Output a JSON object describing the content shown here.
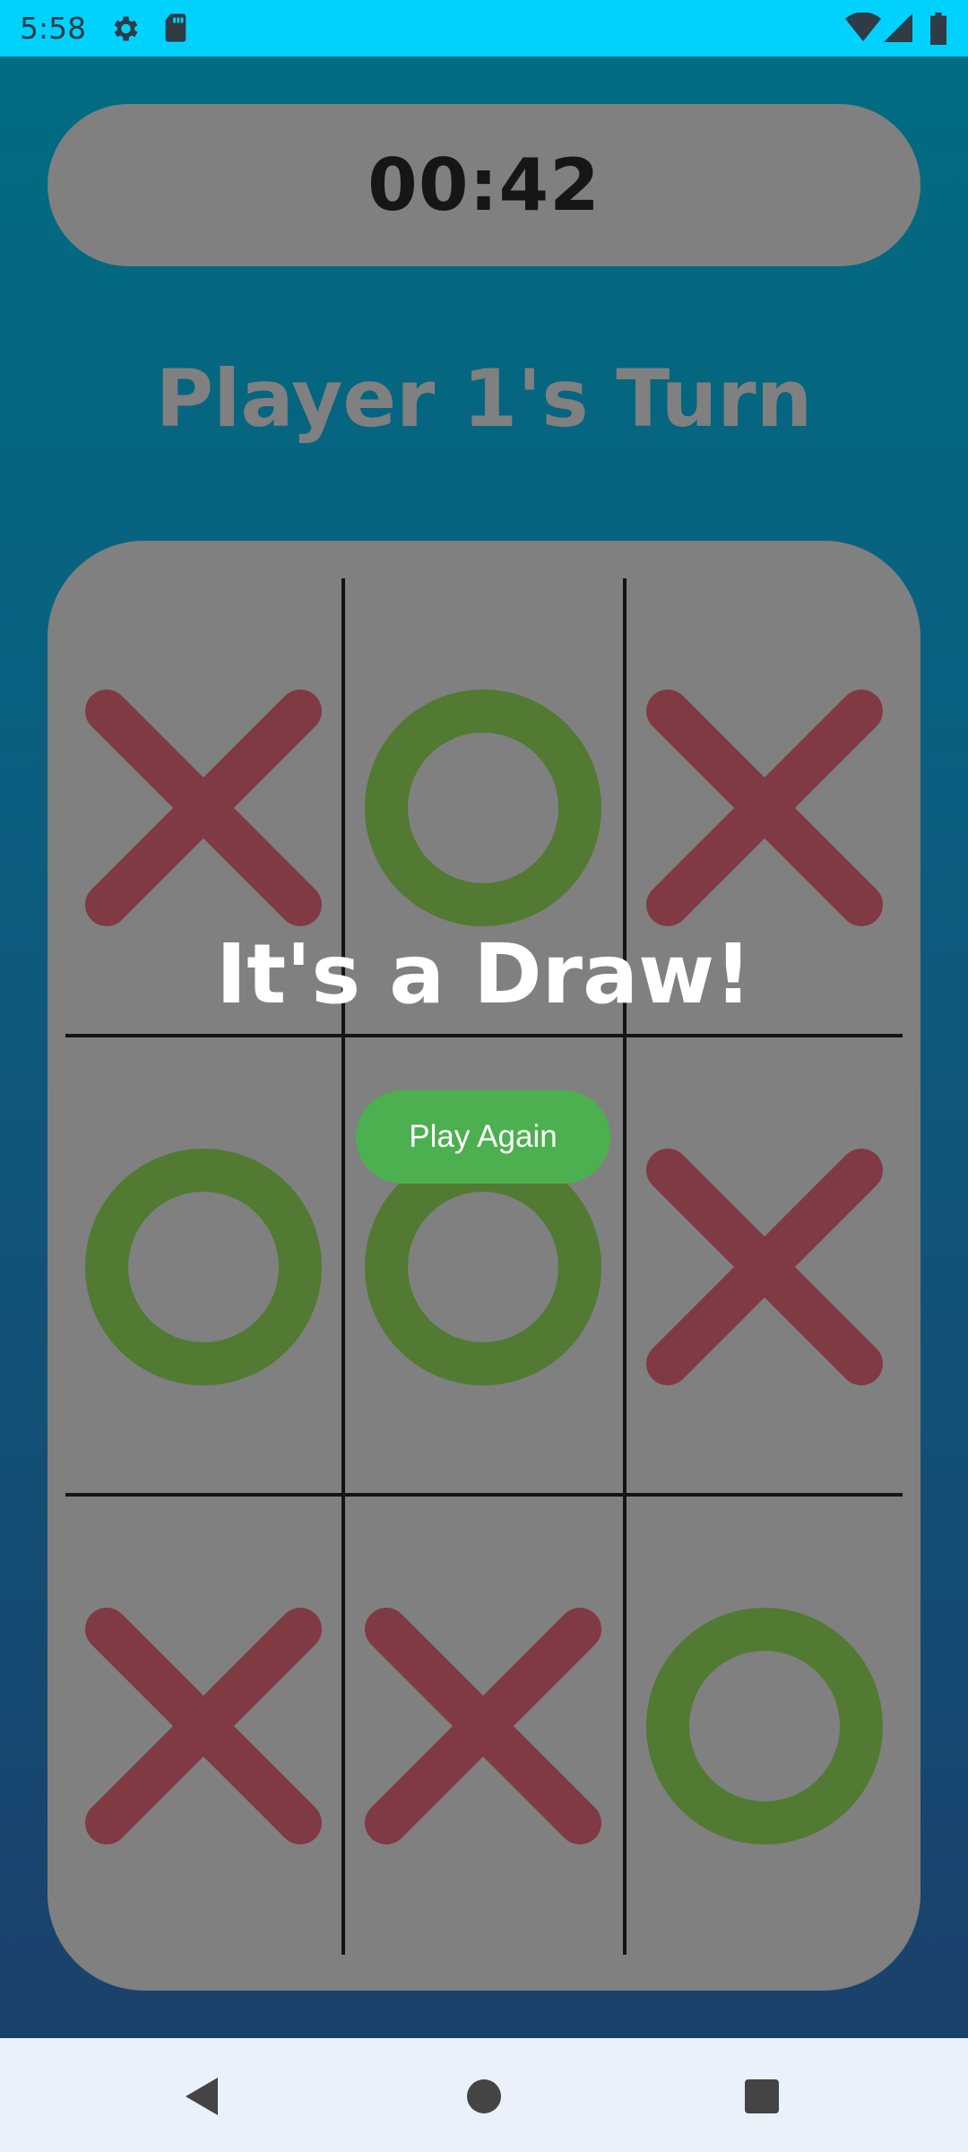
{
  "status_bar": {
    "time": "5:58",
    "left_icons": [
      "settings-icon",
      "sd-card-icon"
    ],
    "right_icons": [
      "wifi-icon",
      "signal-icon",
      "battery-icon"
    ]
  },
  "game": {
    "timer": "00:42",
    "turn_label": "Player 1's Turn",
    "result_title": "It's a Draw!",
    "play_again_label": "Play Again",
    "board": [
      [
        "X",
        "O",
        "X"
      ],
      [
        "O",
        "O",
        "X"
      ],
      [
        "X",
        "X",
        "O"
      ]
    ],
    "colors": {
      "x_mark": "#7f3a44",
      "o_mark": "#527a32",
      "board_bg": "#808080",
      "button_bg": "#4caf50",
      "status_bar": "#00d2ff"
    }
  },
  "nav_bar": {
    "buttons": [
      "back-icon",
      "home-icon",
      "recents-icon"
    ]
  }
}
